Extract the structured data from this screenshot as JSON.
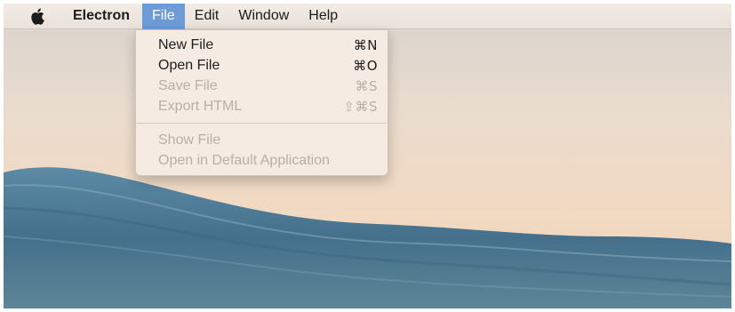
{
  "menubar": {
    "apple_icon": "apple-logo-icon",
    "app_name": "Electron",
    "menus": [
      "File",
      "Edit",
      "Window",
      "Help"
    ],
    "active_menu": "File"
  },
  "file_menu": {
    "items": [
      {
        "label": "New File",
        "shortcut": "⌘N",
        "enabled": true
      },
      {
        "label": "Open File",
        "shortcut": "⌘O",
        "enabled": true
      },
      {
        "label": "Save File",
        "shortcut": "⌘S",
        "enabled": false
      },
      {
        "label": "Export HTML",
        "shortcut": "⇧⌘S",
        "enabled": false
      }
    ],
    "items_after_separator": [
      {
        "label": "Show File",
        "shortcut": "",
        "enabled": false
      },
      {
        "label": "Open in Default Application",
        "shortcut": "",
        "enabled": false
      }
    ]
  },
  "colors": {
    "menu_highlight": "#6e9bd6",
    "wave_blue": "#4f7b96"
  }
}
